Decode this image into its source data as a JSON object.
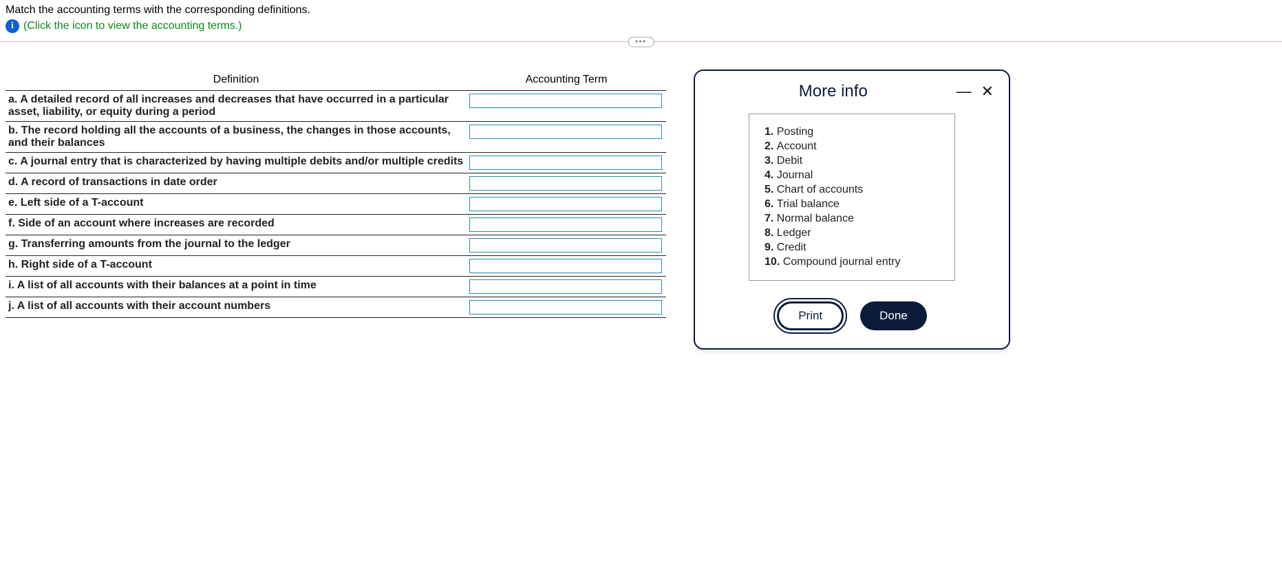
{
  "question": "Match the accounting terms with the corresponding definitions.",
  "hint": "(Click the icon to view the accounting terms.)",
  "table": {
    "header_definition": "Definition",
    "header_term": "Accounting Term",
    "rows": [
      {
        "letter": "a.",
        "text": "A detailed record of all increases and decreases that have occurred in a particular asset, liability, or equity during a period",
        "value": ""
      },
      {
        "letter": "b.",
        "text": "The record holding all the accounts of a business, the changes in those accounts, and their balances",
        "value": ""
      },
      {
        "letter": "c.",
        "text": "A journal entry that is characterized by having multiple debits and/or multiple credits",
        "value": ""
      },
      {
        "letter": "d.",
        "text": "A record of transactions in date order",
        "value": ""
      },
      {
        "letter": "e.",
        "text": "Left side of a T-account",
        "value": ""
      },
      {
        "letter": "f.",
        "text": "Side of an account where increases are recorded",
        "value": ""
      },
      {
        "letter": "g.",
        "text": "Transferring amounts from the journal to the ledger",
        "value": ""
      },
      {
        "letter": "h.",
        "text": "Right side of a T-account",
        "value": ""
      },
      {
        "letter": "i.",
        "text": "A list of all accounts with their balances at a point in time",
        "value": ""
      },
      {
        "letter": "j.",
        "text": "A list of all accounts with their account numbers",
        "value": ""
      }
    ]
  },
  "modal": {
    "title": "More info",
    "terms": [
      {
        "num": "1.",
        "label": "Posting"
      },
      {
        "num": "2.",
        "label": "Account"
      },
      {
        "num": "3.",
        "label": "Debit"
      },
      {
        "num": "4.",
        "label": "Journal"
      },
      {
        "num": "5.",
        "label": "Chart of accounts"
      },
      {
        "num": "6.",
        "label": "Trial balance"
      },
      {
        "num": "7.",
        "label": "Normal balance"
      },
      {
        "num": "8.",
        "label": "Ledger"
      },
      {
        "num": "9.",
        "label": "Credit"
      },
      {
        "num": "10.",
        "label": "Compound journal entry"
      }
    ],
    "print": "Print",
    "done": "Done"
  }
}
